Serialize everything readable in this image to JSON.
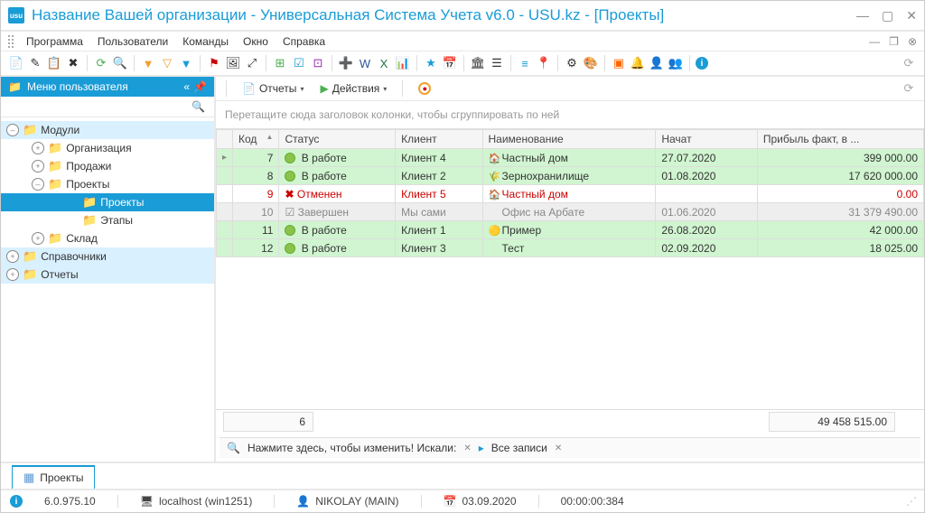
{
  "window": {
    "title": "Название Вашей организации - Универсальная Система Учета v6.0 - USU.kz - [Проекты]"
  },
  "menubar": {
    "items": [
      "Программа",
      "Пользователи",
      "Команды",
      "Окно",
      "Справка"
    ]
  },
  "sidebar": {
    "header": "Меню пользователя",
    "tree": [
      {
        "label": "Модули",
        "level": 0,
        "expanded": true
      },
      {
        "label": "Организация",
        "level": 1,
        "expanded": false
      },
      {
        "label": "Продажи",
        "level": 1,
        "expanded": false
      },
      {
        "label": "Проекты",
        "level": 1,
        "expanded": true
      },
      {
        "label": "Проекты",
        "level": 2,
        "selected": true
      },
      {
        "label": "Этапы",
        "level": 2
      },
      {
        "label": "Склад",
        "level": 1,
        "expanded": false
      },
      {
        "label": "Справочники",
        "level": 0,
        "expanded": false
      },
      {
        "label": "Отчеты",
        "level": 0,
        "expanded": false
      }
    ]
  },
  "content_toolbar": {
    "reports": "Отчеты",
    "actions": "Действия"
  },
  "group_hint": "Перетащите сюда заголовок колонки, чтобы сгруппировать по ней",
  "grid": {
    "columns": [
      "Код",
      "Статус",
      "Клиент",
      "Наименование",
      "Начат",
      "Прибыль факт, в ..."
    ],
    "rows": [
      {
        "code": "7",
        "status": "В работе",
        "status_kind": "work",
        "client": "Клиент 4",
        "name": "Частный дом",
        "name_icon": "🏠",
        "date": "27.07.2020",
        "profit": "399 000.00",
        "row_style": "green",
        "active": true
      },
      {
        "code": "8",
        "status": "В работе",
        "status_kind": "work",
        "client": "Клиент 2",
        "name": "Зернохранилище",
        "name_icon": "🌾",
        "date": "01.08.2020",
        "profit": "17 620 000.00",
        "row_style": "green"
      },
      {
        "code": "9",
        "status": "Отменен",
        "status_kind": "cancel",
        "client": "Клиент 5",
        "name": "Частный дом",
        "name_icon": "🏠",
        "date": "",
        "profit": "0.00",
        "row_style": "white",
        "red": true
      },
      {
        "code": "10",
        "status": "Завершен",
        "status_kind": "done",
        "client": "Мы сами",
        "name": "Офис на Арбате",
        "name_icon": "",
        "date": "01.06.2020",
        "profit": "31 379 490.00",
        "row_style": "gray"
      },
      {
        "code": "11",
        "status": "В работе",
        "status_kind": "work",
        "client": "Клиент 1",
        "name": "Пример",
        "name_icon": "🟡",
        "date": "26.08.2020",
        "profit": "42 000.00",
        "row_style": "green"
      },
      {
        "code": "12",
        "status": "В работе",
        "status_kind": "work",
        "client": "Клиент 3",
        "name": "Тест",
        "name_icon": "",
        "date": "02.09.2020",
        "profit": "18 025.00",
        "row_style": "green"
      }
    ],
    "summary": {
      "count": "6",
      "total": "49 458 515.00"
    }
  },
  "search_bar": {
    "hint": "Нажмите здесь, чтобы изменить! Искали:",
    "filter": "Все записи"
  },
  "tabs": {
    "active": "Проекты"
  },
  "statusbar": {
    "version": "6.0.975.10",
    "host": "localhost (win1251)",
    "user": "NIKOLAY (MAIN)",
    "date": "03.09.2020",
    "time": "00:00:00:384"
  }
}
